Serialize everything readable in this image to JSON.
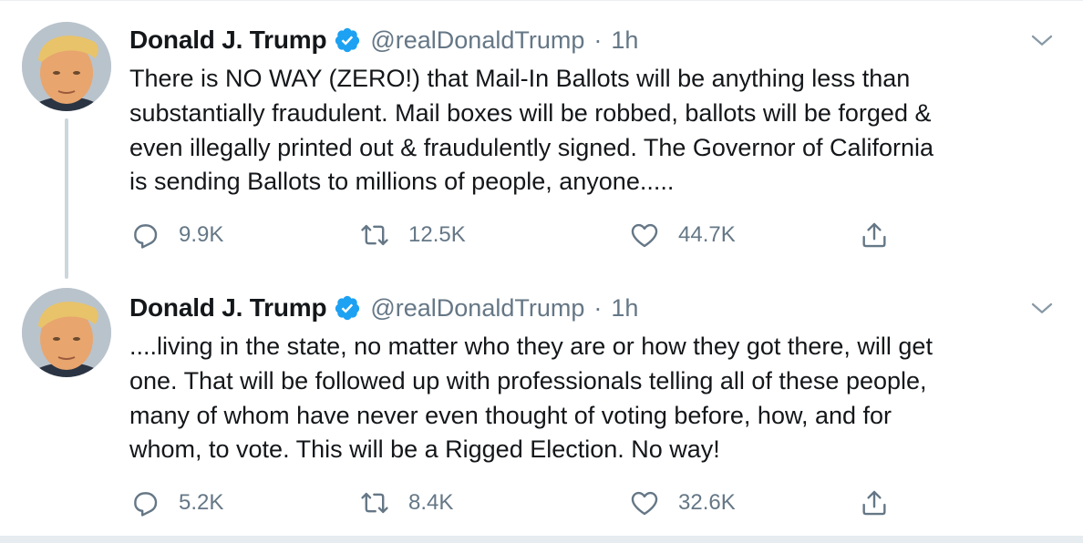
{
  "tweets": [
    {
      "author": {
        "name": "Donald J. Trump",
        "handle": "@realDonaldTrump",
        "verified": true
      },
      "separator": "·",
      "time": "1h",
      "text_lines": [
        "There is NO WAY (ZERO!) that Mail-In Ballots will be anything less than",
        "substantially fraudulent. Mail boxes will be robbed, ballots will be forged &",
        "even illegally printed out & fraudulently signed. The Governor of California",
        "is sending Ballots to millions of people, anyone....."
      ],
      "actions": {
        "replies": "9.9K",
        "retweets": "12.5K",
        "likes": "44.7K"
      }
    },
    {
      "author": {
        "name": "Donald J. Trump",
        "handle": "@realDonaldTrump",
        "verified": true
      },
      "separator": "·",
      "time": "1h",
      "text_lines": [
        "....living in the state, no matter who they are or how they got there, will get",
        "one. That will be followed up with professionals telling all of these people,",
        "many of whom have never even thought of voting before, how, and for",
        "whom, to vote. This will be a Rigged Election. No way!"
      ],
      "actions": {
        "replies": "5.2K",
        "retweets": "8.4K",
        "likes": "32.6K"
      }
    }
  ],
  "icons": {
    "verified": "verified-badge-icon",
    "caret": "chevron-down-icon",
    "reply": "reply-icon",
    "retweet": "retweet-icon",
    "like": "heart-icon",
    "share": "share-icon"
  },
  "colors": {
    "text_primary": "#14171a",
    "text_secondary": "#657786",
    "verified_blue": "#1da1f2",
    "thread_line": "#ccd6dd",
    "background": "#ffffff",
    "divider": "#e6ecf0"
  }
}
